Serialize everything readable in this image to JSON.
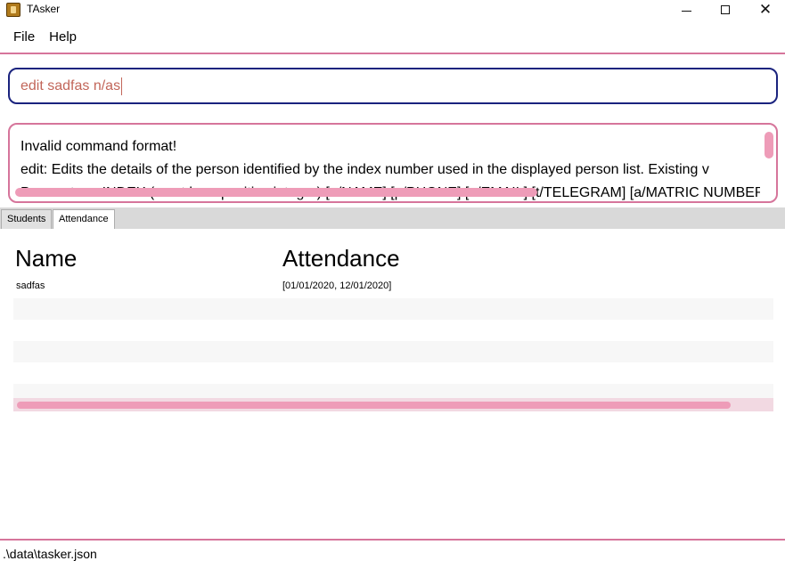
{
  "window": {
    "title": "TAsker",
    "controls": {
      "minimize": "minimize-icon",
      "maximize": "maximize-icon",
      "close": "✕"
    }
  },
  "menu": {
    "items": [
      "File",
      "Help"
    ]
  },
  "command_box": {
    "value": "edit sadfas n/as"
  },
  "result_display": {
    "lines": [
      "Invalid command format!",
      "edit: Edits the details of the person identified by the index number used in the displayed person list. Existing v",
      "Parameters: INDEX (must be a positive integer) [n/NAME] [p/PHONE] [e/EMAIL] [t/TELEGRAM] [a/MATRIC NUMBER]"
    ]
  },
  "tabs": [
    {
      "label": "Students",
      "selected": false
    },
    {
      "label": "Attendance",
      "selected": true
    }
  ],
  "table": {
    "columns": [
      "Name",
      "Attendance"
    ],
    "rows": [
      {
        "name": "sadfas",
        "attendance": "[01/01/2020, 12/01/2020]"
      }
    ]
  },
  "status_bar": {
    "path": ".\\data\\tasker.json"
  },
  "colors": {
    "accent": "#d6759b",
    "command_border": "#1a237e",
    "command_text": "#c2665a",
    "scroll_thumb": "#ee9cb8"
  }
}
